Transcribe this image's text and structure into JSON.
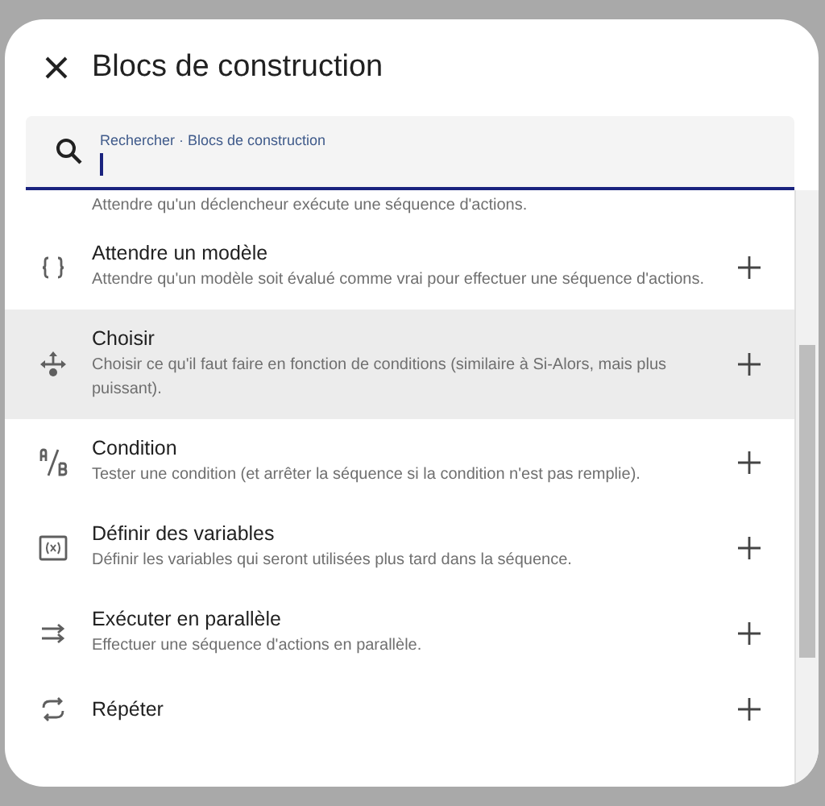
{
  "dialog": {
    "title": "Blocs de construction"
  },
  "search": {
    "label": "Rechercher · Blocs de construction"
  },
  "items": [
    {
      "description": "Attendre qu'un déclencheur exécute une séquence d'actions.",
      "selected": false
    },
    {
      "kind": "braces",
      "title": "Attendre un modèle",
      "description": "Attendre qu'un modèle soit évalué comme vrai pour effectuer une séquence d'actions.",
      "selected": false
    },
    {
      "kind": "split",
      "title": "Choisir",
      "description": "Choisir ce qu'il faut faire en fonction de conditions (similaire à Si-Alors, mais plus puissant).",
      "selected": true
    },
    {
      "kind": "ab",
      "title": "Condition",
      "description": "Tester une condition (et arrêter la séquence si la condition n'est pas remplie).",
      "selected": false
    },
    {
      "kind": "variable",
      "title": "Définir des variables",
      "description": "Définir les variables qui seront utilisées plus tard dans la séquence.",
      "selected": false
    },
    {
      "kind": "parallel",
      "title": "Exécuter en parallèle",
      "description": "Effectuer une séquence d'actions en parallèle.",
      "selected": false
    },
    {
      "kind": "repeat",
      "title": "Répéter",
      "selected": false
    }
  ]
}
